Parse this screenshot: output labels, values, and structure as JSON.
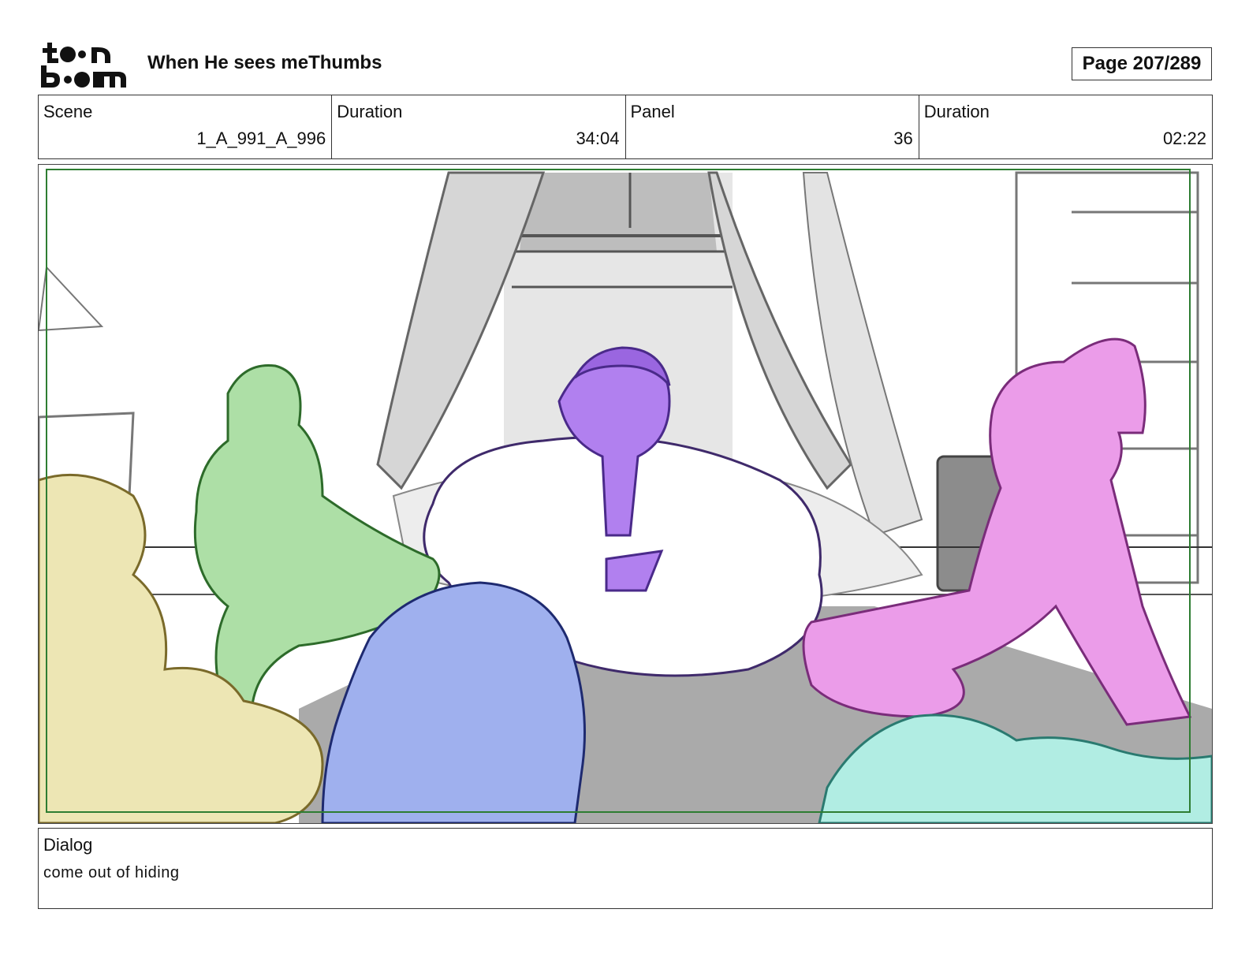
{
  "header": {
    "logo_text_top": "toon",
    "logo_text_bottom": "boom",
    "title": "When He sees meThumbs",
    "page": "Page 207/289"
  },
  "info": [
    {
      "label": "Scene",
      "value": "1_A_991_A_996"
    },
    {
      "label": "Duration",
      "value": "34:04"
    },
    {
      "label": "Panel",
      "value": "36"
    },
    {
      "label": "Duration",
      "value": "02:22"
    }
  ],
  "panel": {
    "colors": {
      "safe_frame": "#2e7d32",
      "yellow": "#ede6b4",
      "green": "#addfa6",
      "blue": "#9fb0ee",
      "purple": "#b180ef",
      "pink": "#eb9ce9",
      "cyan": "#b1ede3",
      "floor": "#aaaaaa"
    }
  },
  "dialog": {
    "label": "Dialog",
    "text": "come out of hiding"
  }
}
